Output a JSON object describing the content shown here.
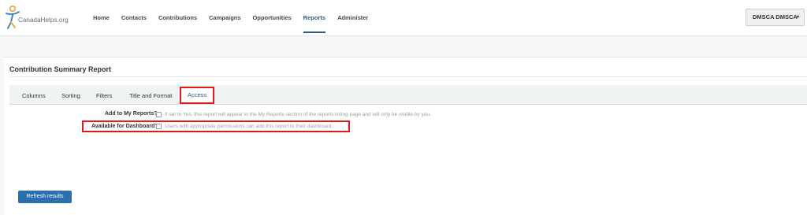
{
  "header": {
    "logo_text": "CanadaHelps.org",
    "nav": [
      "Home",
      "Contacts",
      "Contributions",
      "Campaigns",
      "Opportunities",
      "Reports",
      "Administer"
    ],
    "active_nav": "Reports",
    "user_menu": {
      "label": "DMSCA DMSCA",
      "caret": "▾"
    }
  },
  "report": {
    "title": "Contribution Summary Report",
    "tabs": [
      "Columns",
      "Sorting",
      "Filters",
      "Title and Format",
      "Access"
    ],
    "active_tab": "Access"
  },
  "access": {
    "add_to_my_reports": {
      "label": "Add to My Reports?",
      "checked": false,
      "help": "If set to Yes, this report will appear in the My Reports section of the reports listing page and will only be visible by you."
    },
    "available_for_dashboard": {
      "label": "Available for Dashboard?",
      "checked": false,
      "help": "Users with appropriate permissions can add this report to their dashboard."
    }
  },
  "actions": {
    "refresh_label": "Refresh results"
  },
  "colors": {
    "brand": "#2a5d8f",
    "button": "#2b6fae",
    "highlight": "#e01919",
    "tab_bar": "#eef3f4"
  }
}
